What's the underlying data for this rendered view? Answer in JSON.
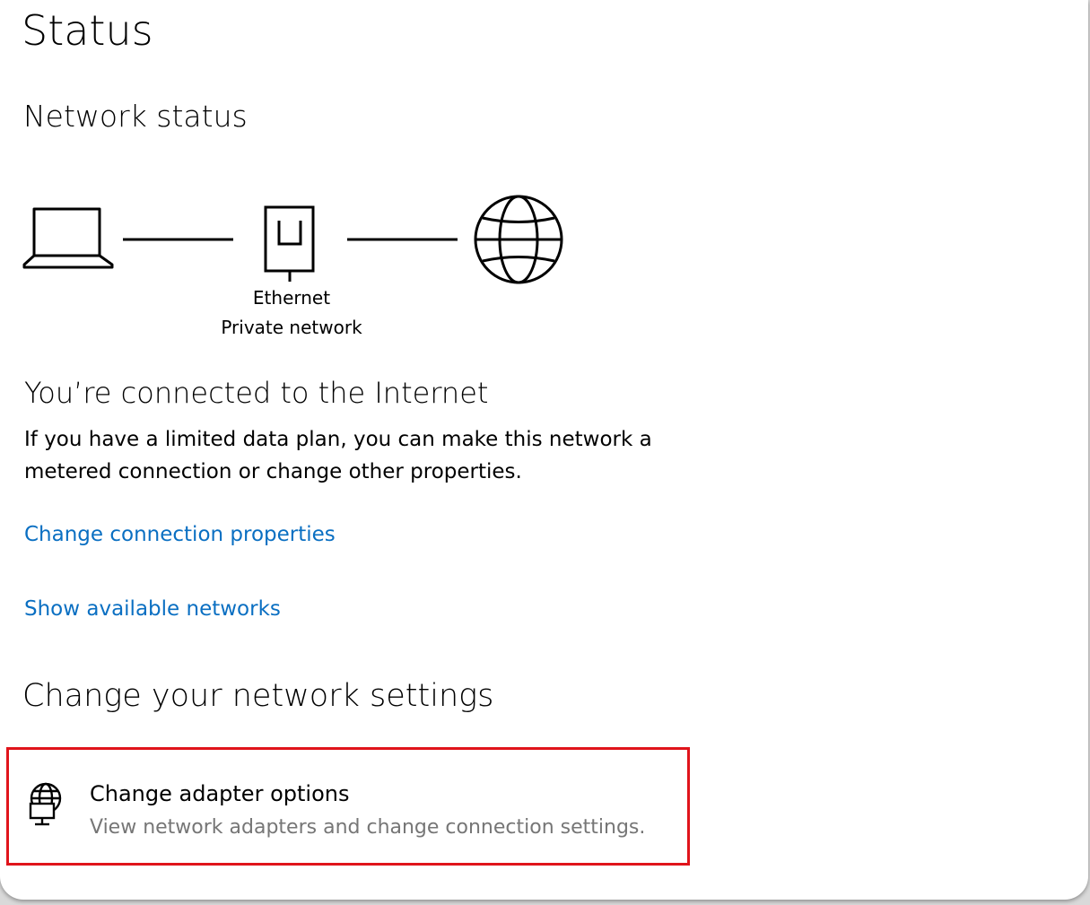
{
  "page": {
    "title": "Status"
  },
  "network_status": {
    "title": "Network status",
    "connection_name": "Ethernet",
    "connection_profile": "Private network",
    "icons": [
      "laptop-icon",
      "ethernet-icon",
      "globe-icon"
    ]
  },
  "connection": {
    "title": "You’re connected to the Internet",
    "description": "If you have a limited data plan, you can make this network a metered connection or change other properties.",
    "links": {
      "change_properties": "Change connection properties",
      "show_networks": "Show available networks"
    }
  },
  "settings": {
    "title": "Change your network settings",
    "adapter_option": {
      "icon": "network-adapter-icon",
      "title": "Change adapter options",
      "description": "View network adapters and change connection settings."
    }
  },
  "colors": {
    "link": "#0a6fc2",
    "highlight_border": "#e0141b",
    "secondary_text": "#767676"
  }
}
